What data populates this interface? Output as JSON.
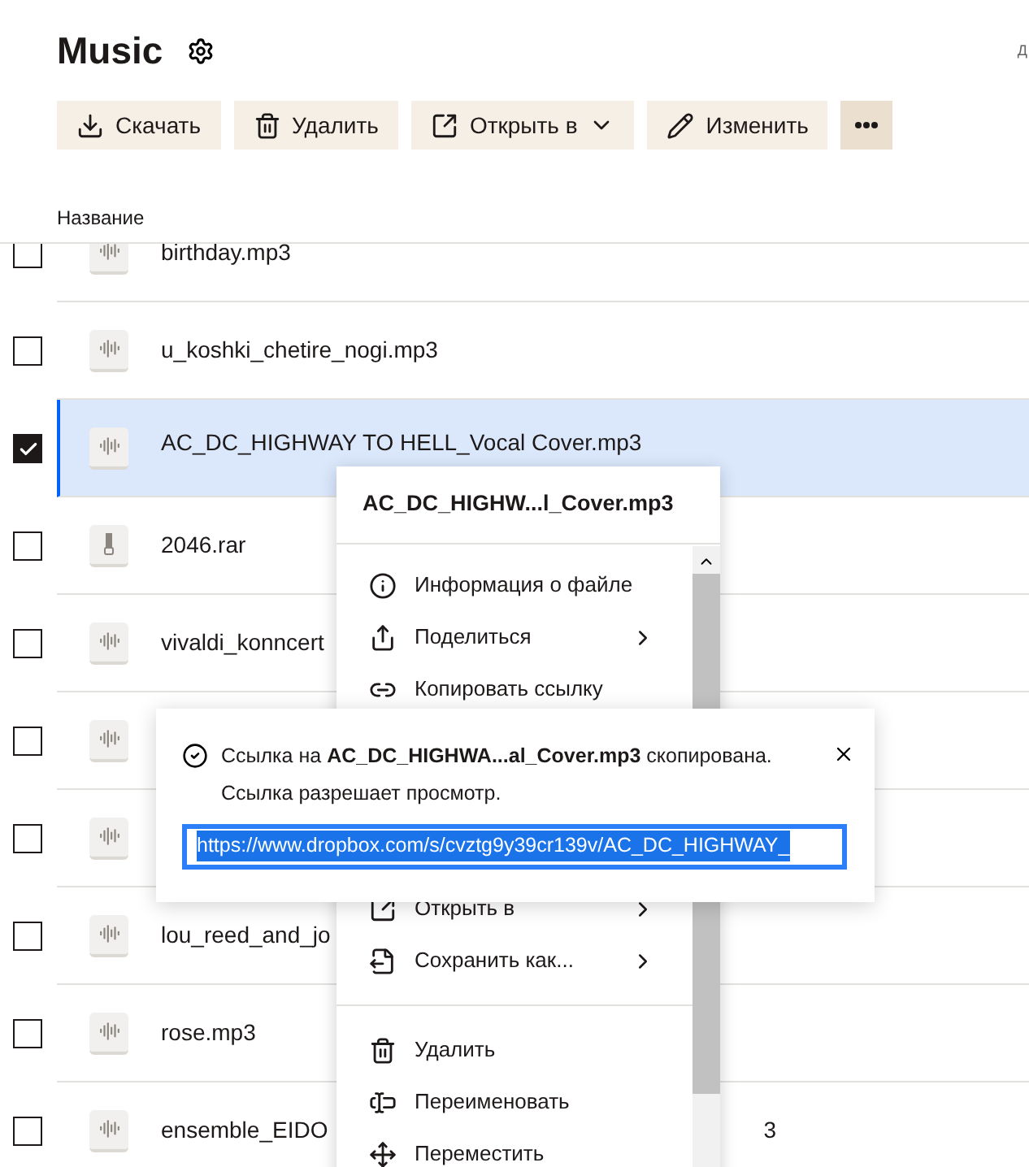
{
  "header": {
    "title": "Music",
    "edge_fragment": "Д"
  },
  "toolbar": [
    {
      "label": "Скачать",
      "kind": "download"
    },
    {
      "label": "Удалить",
      "kind": "delete"
    },
    {
      "label": "Открыть в",
      "kind": "open"
    },
    {
      "label": "Изменить",
      "kind": "edit"
    },
    {
      "kind": "more"
    }
  ],
  "table": {
    "columns": [
      "Название"
    ],
    "rows": [
      {
        "name": "birthday.mp3",
        "kind": "audio",
        "selected": false
      },
      {
        "name": "u_koshki_chetire_nogi.mp3",
        "kind": "audio",
        "selected": false
      },
      {
        "name": "AC_DC_HIGHWAY TO HELL_Vocal Cover.mp3",
        "kind": "audio",
        "selected": true
      },
      {
        "name": "2046.rar",
        "kind": "archive",
        "selected": false
      },
      {
        "name": "vivaldi_konncert",
        "kind": "audio",
        "selected": false
      },
      {
        "kind": "audio",
        "selected": false
      },
      {
        "kind": "audio",
        "selected": false
      },
      {
        "name": "lou_reed_and_jo",
        "kind": "audio",
        "selected": false
      },
      {
        "name": "rose.mp3",
        "kind": "audio",
        "selected": false
      },
      {
        "name": "ensemble_EIDO",
        "tail": "3",
        "kind": "audio",
        "selected": false
      }
    ]
  },
  "context_menu": {
    "title": "AC_DC_HIGHW...l_Cover.mp3",
    "top_items": [
      {
        "label": "Информация о файле",
        "kind": "info",
        "submenu": false
      },
      {
        "label": "Поделиться",
        "kind": "share",
        "submenu": true
      },
      {
        "label": "Копировать ссылку",
        "kind": "link",
        "submenu": false
      }
    ],
    "middle_items": [
      {
        "label": "Открыть в",
        "kind": "open",
        "submenu": true
      },
      {
        "label": "Сохранить как...",
        "kind": "save",
        "submenu": true
      }
    ],
    "bottom_items": [
      {
        "label": "Удалить",
        "kind": "delete",
        "submenu": false
      },
      {
        "label": "Переименовать",
        "kind": "rename",
        "submenu": false
      },
      {
        "label": "Переместить",
        "kind": "move",
        "submenu": false
      }
    ]
  },
  "toast": {
    "message": "Ссылка на **AC_DC_HIGHWA...al_Cover.mp3** скопирована.",
    "note": "Ссылка разрешает просмотр.",
    "link_value": "https://www.dropbox.com/s/cvztg9y39cr139v/AC_DC_HIGHWAY_"
  }
}
